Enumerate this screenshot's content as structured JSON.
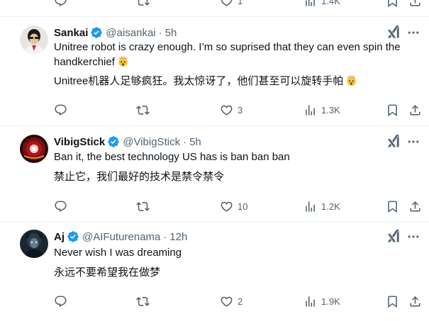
{
  "top_partial": {
    "like_count": "1",
    "views_count": "1.4K"
  },
  "tweets": [
    {
      "name": "Sankai",
      "handle": "@aisankai",
      "time": "5h",
      "text_en": "Unitree robot is crazy enough. I’m so suprised that they can even spin the handkerchief",
      "text_zh": "Unitree机器人足够疯狂。我太惊讶了，他们甚至可以旋转手帕",
      "emoji_en": "exploding-head",
      "emoji_zh": "exploding-head",
      "replies": "",
      "reposts": "",
      "likes": "3",
      "views": "1.3K"
    },
    {
      "name": "VibigStick",
      "handle": "@VibigStick",
      "time": "5h",
      "text_en": "Ban it, the best technology US has is ban ban ban",
      "text_zh": "禁止它，我们最好的技术是禁令禁令",
      "replies": "",
      "reposts": "",
      "likes": "10",
      "views": "1.2K"
    },
    {
      "name": "Aj",
      "handle": "@AIFuturenama",
      "time": "12h",
      "text_en": "Never wish I was dreaming",
      "text_zh": "永远不要希望我在做梦",
      "replies": "",
      "reposts": "",
      "likes": "2",
      "views": "1.9K"
    }
  ],
  "colors": {
    "text": "#0f1419",
    "secondary": "#536471",
    "verified": "#1d9bf0",
    "border": "#eff3f4"
  },
  "icons": [
    "reply-icon",
    "repost-icon",
    "like-icon",
    "views-icon",
    "bookmark-icon",
    "share-icon",
    "grok-icon",
    "more-icon",
    "verified-badge-icon"
  ]
}
